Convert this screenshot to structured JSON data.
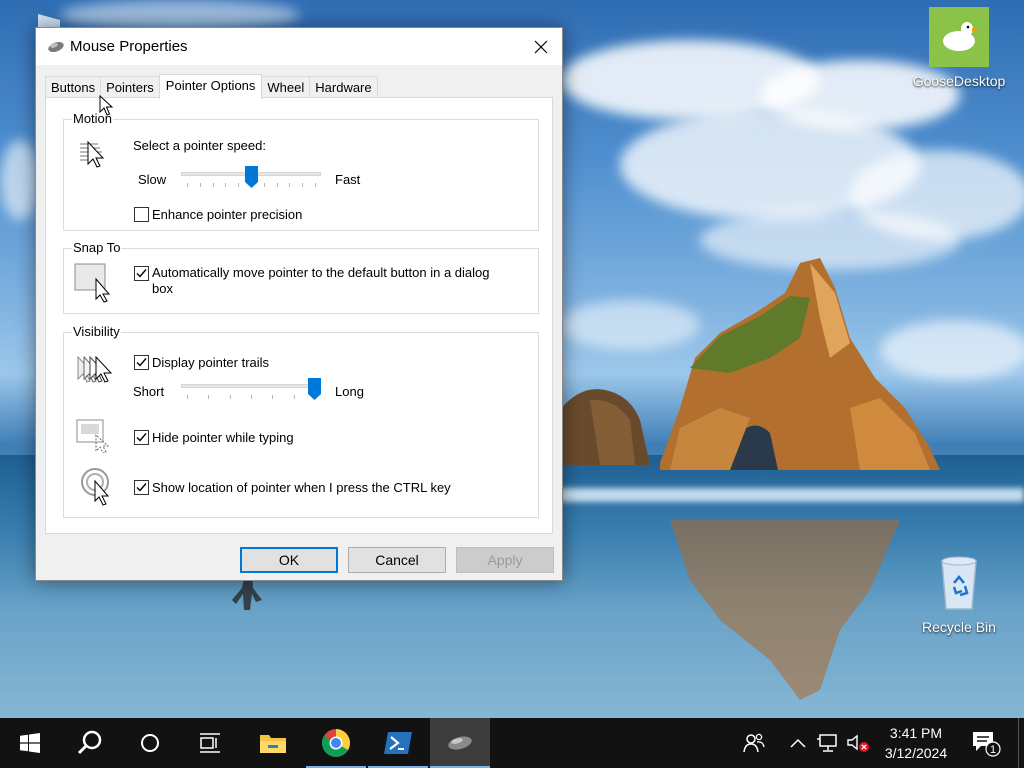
{
  "desktop": {
    "icons": [
      {
        "label": "GooseDesktop",
        "icon": "goose-icon"
      },
      {
        "label": "Recycle Bin",
        "icon": "recycle-bin-icon"
      }
    ]
  },
  "window": {
    "title": "Mouse Properties",
    "tabs": [
      {
        "label": "Buttons",
        "active": false
      },
      {
        "label": "Pointers",
        "active": false
      },
      {
        "label": "Pointer Options",
        "active": true
      },
      {
        "label": "Wheel",
        "active": false
      },
      {
        "label": "Hardware",
        "active": false
      }
    ],
    "motion": {
      "group_label": "Motion",
      "speed_label": "Select a pointer speed:",
      "slow": "Slow",
      "fast": "Fast",
      "speed_level": 0.5,
      "precision_label": "Enhance pointer precision",
      "precision_checked": false
    },
    "snap_to": {
      "group_label": "Snap To",
      "auto_label_line1": "Automatically move pointer to the default button in a dialog",
      "auto_label_line2": "box",
      "auto_checked": true
    },
    "visibility": {
      "group_label": "Visibility",
      "trails_label": "Display pointer trails",
      "trails_checked": true,
      "short": "Short",
      "long": "Long",
      "trail_level": 1.0,
      "hide_label": "Hide pointer while typing",
      "hide_checked": true,
      "ctrl_label": "Show location of pointer when I press the CTRL key",
      "ctrl_checked": true
    },
    "buttons": {
      "ok": "OK",
      "cancel": "Cancel",
      "apply": "Apply"
    }
  },
  "taskbar": {
    "apps": [
      "start-icon",
      "search-icon",
      "cortana-icon",
      "task-view-icon",
      "file-explorer-icon",
      "chrome-icon",
      "powershell-icon",
      "mouse-properties-icon"
    ],
    "time": "3:41 PM",
    "date": "3/12/2024",
    "notification_count": "1"
  },
  "colors": {
    "accent": "#0078d7",
    "taskbar": "#121212",
    "dialog_bg": "#f0f0f0"
  }
}
